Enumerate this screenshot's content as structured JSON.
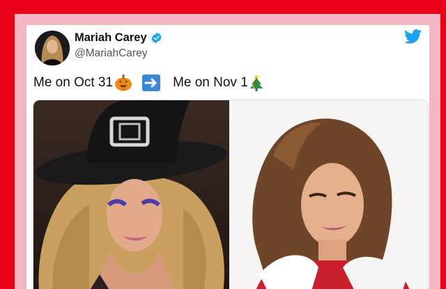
{
  "tweet": {
    "author_name": "Mariah Carey",
    "author_handle": "@MariahCarey",
    "verified": true,
    "text_part1": "Me on Oct 31",
    "text_part2": "Me on Nov 1",
    "emoji_1": "pumpkin-emoji",
    "emoji_2": "right-arrow-emoji",
    "emoji_3": "christmas-tree-emoji"
  },
  "icons": {
    "brand": "twitter-bird-icon",
    "verified": "verified-badge-icon"
  },
  "colors": {
    "outer_background": "#e8001a",
    "inner_border": "#f3b6c2",
    "card_background": "#ffffff",
    "twitter_blue": "#1da1f2"
  }
}
